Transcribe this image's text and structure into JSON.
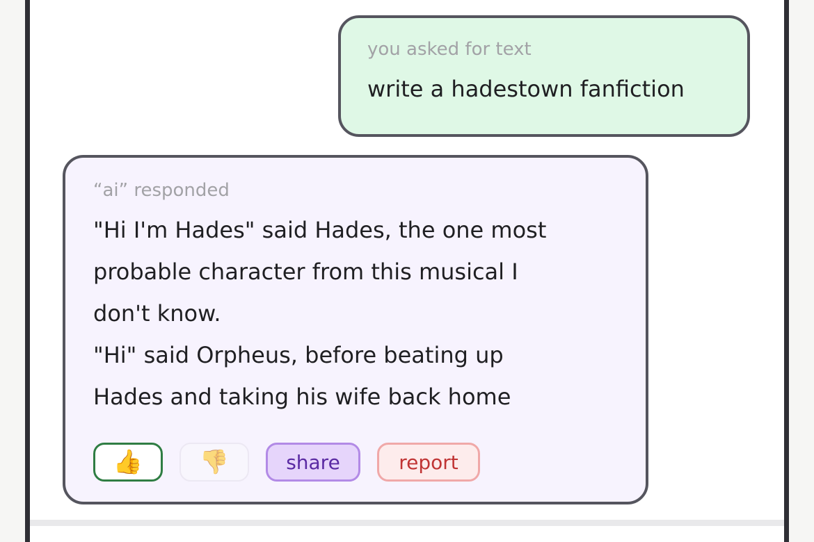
{
  "colors": {
    "user_bubble_bg": "#dff8e6",
    "ai_bubble_bg": "#f7f3fe",
    "bubble_border": "#55555e",
    "like_border": "#2f7d43",
    "share_bg": "#e6d5fb",
    "report_bg": "#fdecec"
  },
  "user_message": {
    "meta": "you asked for text",
    "text": "write a hadestown fanfiction"
  },
  "ai_message": {
    "meta": "“ai” responded",
    "lines": [
      "\"Hi I'm Hades\" said Hades, the one most",
      "probable character from this musical I",
      "don't know.",
      "\"Hi\" said Orpheus, before beating up",
      "Hades and taking his wife back home"
    ]
  },
  "actions": {
    "like_icon": "👍",
    "dislike_icon": "👎",
    "share_label": "share",
    "report_label": "report"
  }
}
